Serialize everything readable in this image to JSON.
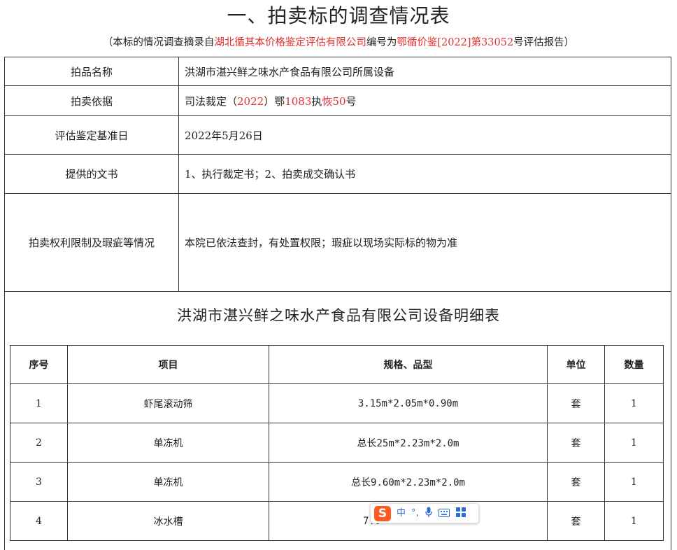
{
  "header": {
    "title": "一、拍卖标的调查情况表",
    "subtitle": {
      "prefix": "（本标的情况调查摘录自",
      "company": "湖北循其本价格鉴定评估有限公司",
      "middle": "编号为",
      "report_no": "鄂循价鉴[2022]第33052",
      "suffix": "号评估报告）"
    }
  },
  "info": {
    "item_name_label": "拍品名称",
    "item_name_value": "洪湖市湛兴鲜之味水产食品有限公司所属设备",
    "basis_label": "拍卖依据",
    "basis_prefix": "司法裁定（",
    "basis_year": "2022",
    "basis_mid1": "）鄂",
    "basis_num": "1083",
    "basis_mid2": "执",
    "basis_red2": "恢50",
    "basis_suffix": "号",
    "date_label": "评估鉴定基准日",
    "date_value": "2022年5月26日",
    "docs_label": "提供的文书",
    "docs_value": "1、执行裁定书；2、拍卖成交确认书",
    "rights_label": "拍卖权利限制及瑕疵等情况",
    "rights_value": "本院已依法查封，有处置权限；瑕疵以现场实际标的物为准"
  },
  "detail_table": {
    "title": "洪湖市湛兴鲜之味水产食品有限公司设备明细表",
    "headers": [
      "序号",
      "项目",
      "规格、品型",
      "单位",
      "数量"
    ],
    "rows": [
      [
        "1",
        "虾尾滚动筛",
        "3.15m*2.05m*0.90m",
        "套",
        "1"
      ],
      [
        "2",
        "单冻机",
        "总长25m*2.23m*2.0m",
        "套",
        "1"
      ],
      [
        "3",
        "单冻机",
        "总长9.60m*2.23m*2.0m",
        "套",
        "1"
      ],
      [
        "4",
        "冰水槽",
        "7.0",
        "套",
        "1"
      ]
    ]
  },
  "ime_toolbar": {
    "logo": "S",
    "mode": "中",
    "punct": "°,",
    "icons": [
      "microphone-icon",
      "keyboard-icon",
      "grid-icon"
    ]
  }
}
